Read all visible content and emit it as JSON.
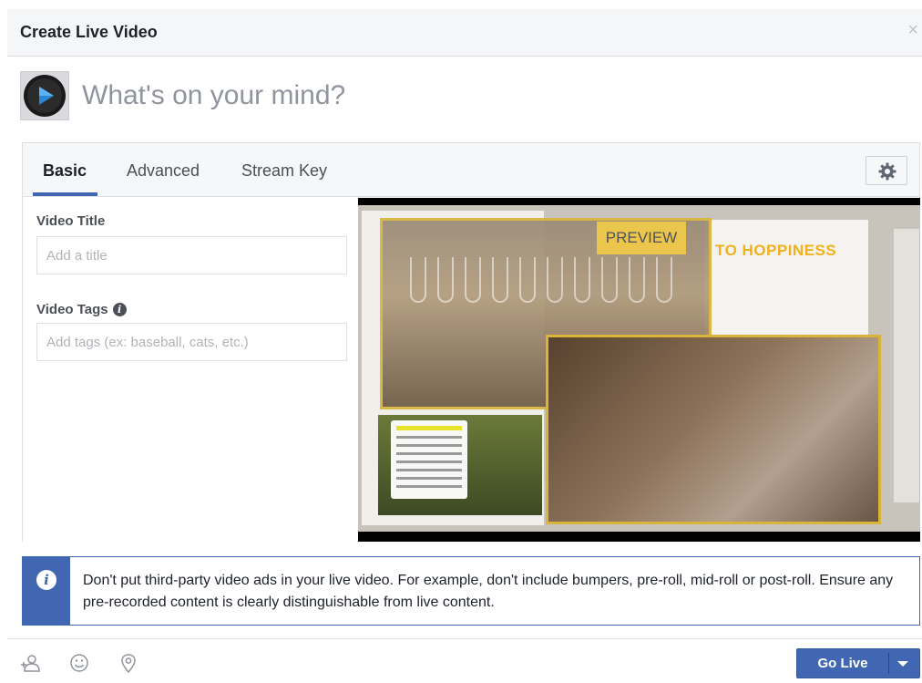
{
  "dialog": {
    "title": "Create Live Video",
    "close_glyph": "×"
  },
  "composer": {
    "placeholder": "What's on your mind?",
    "avatar_icon": "play-logo-icon"
  },
  "tabs": [
    {
      "label": "Basic",
      "active": true
    },
    {
      "label": "Advanced",
      "active": false
    },
    {
      "label": "Stream Key",
      "active": false
    }
  ],
  "settings": {
    "icon": "gear-icon"
  },
  "form": {
    "video_title_label": "Video Title",
    "video_title_placeholder": "Add a title",
    "video_tags_label": "Video Tags",
    "video_tags_placeholder": "Add tags (ex: baseball, cats, etc.)"
  },
  "preview": {
    "badge": "PREVIEW",
    "headline": "TO HOPPINESS"
  },
  "notice": {
    "icon": "info-icon",
    "text": "Don't put third-party video ads in your live video. For example, don't include bumpers, pre-roll, mid-roll or post-roll. Ensure any pre-recorded content is clearly distinguishable from live content."
  },
  "footer": {
    "icons": [
      "tag-people-icon",
      "feeling-icon",
      "location-icon"
    ],
    "go_live_label": "Go Live"
  },
  "colors": {
    "brand_blue": "#4267b2",
    "header_bg": "#f5f6f7",
    "border": "#dddfe2",
    "preview_frame": "#d8b43a"
  }
}
